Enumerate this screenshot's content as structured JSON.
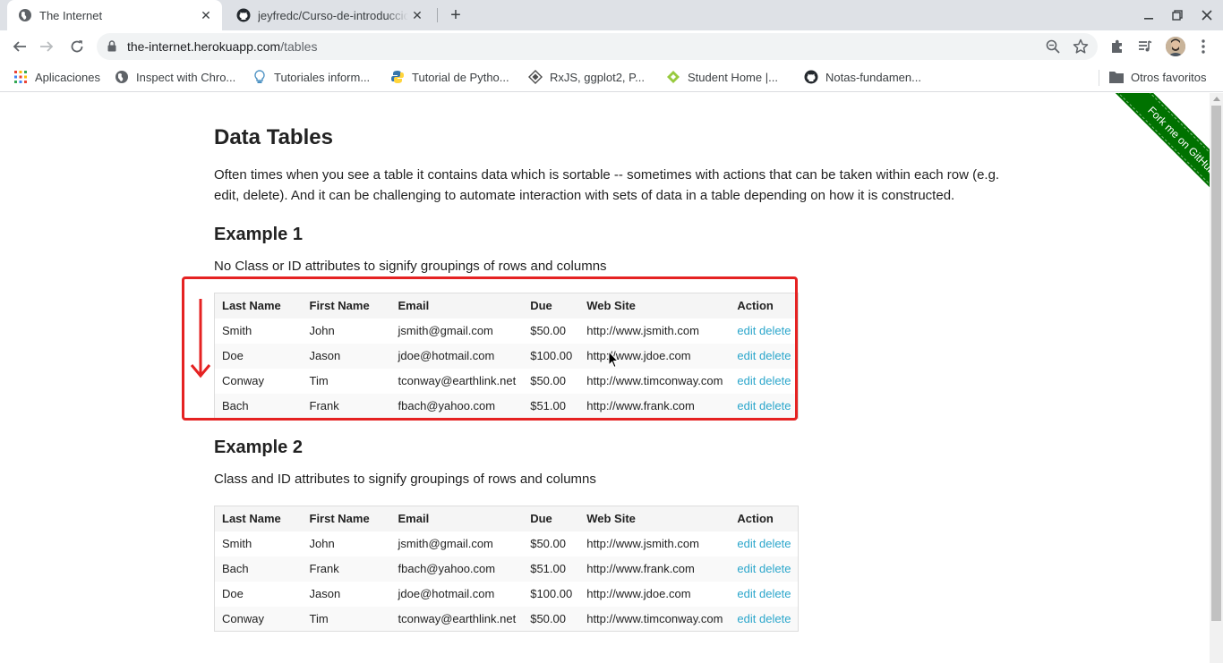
{
  "browser": {
    "tabs": [
      {
        "title": "The Internet",
        "active": true
      },
      {
        "title": "jeyfredc/Curso-de-introduccio",
        "active": false
      }
    ],
    "url_host": "the-internet.herokuapp.com",
    "url_path": "/tables",
    "bookmarks": [
      {
        "label": "Aplicaciones",
        "icon": "apps-grid-icon"
      },
      {
        "label": "Inspect with Chro...",
        "icon": "globe-icon"
      },
      {
        "label": "Tutoriales inform...",
        "icon": "lightbulb-icon"
      },
      {
        "label": "Tutorial de Pytho...",
        "icon": "python-icon"
      },
      {
        "label": "RxJS, ggplot2, P...",
        "icon": "diamond-icon"
      },
      {
        "label": "Student Home |...",
        "icon": "green-diamond-icon"
      },
      {
        "label": "Notas-fundamen...",
        "icon": "github-icon"
      }
    ],
    "other_bookmarks": "Otros favoritos"
  },
  "page": {
    "title": "Data Tables",
    "intro": "Often times when you see a table it contains data which is sortable -- sometimes with actions that can be taken within each row (e.g. edit, delete). And it can be challenging to automate interaction with sets of data in a table depending on how it is constructed.",
    "ribbon": "Fork me on GitHub",
    "example1": {
      "heading": "Example 1",
      "description": "No Class or ID attributes to signify groupings of rows and columns"
    },
    "example2": {
      "heading": "Example 2",
      "description": "Class and ID attributes to signify groupings of rows and columns"
    },
    "columns": [
      "Last Name",
      "First Name",
      "Email",
      "Due",
      "Web Site",
      "Action"
    ],
    "edit_label": "edit",
    "delete_label": "delete",
    "table1": [
      [
        "Smith",
        "John",
        "jsmith@gmail.com",
        "$50.00",
        "http://www.jsmith.com"
      ],
      [
        "Doe",
        "Jason",
        "jdoe@hotmail.com",
        "$100.00",
        "http://www.jdoe.com"
      ],
      [
        "Conway",
        "Tim",
        "tconway@earthlink.net",
        "$50.00",
        "http://www.timconway.com"
      ],
      [
        "Bach",
        "Frank",
        "fbach@yahoo.com",
        "$51.00",
        "http://www.frank.com"
      ]
    ],
    "table2": [
      [
        "Smith",
        "John",
        "jsmith@gmail.com",
        "$50.00",
        "http://www.jsmith.com"
      ],
      [
        "Bach",
        "Frank",
        "fbach@yahoo.com",
        "$51.00",
        "http://www.frank.com"
      ],
      [
        "Doe",
        "Jason",
        "jdoe@hotmail.com",
        "$100.00",
        "http://www.jdoe.com"
      ],
      [
        "Conway",
        "Tim",
        "tconway@earthlink.net",
        "$50.00",
        "http://www.timconway.com"
      ]
    ]
  },
  "colors": {
    "link": "#2ba6cb",
    "annotation_red": "#e52222",
    "ribbon_green": "#007200"
  }
}
